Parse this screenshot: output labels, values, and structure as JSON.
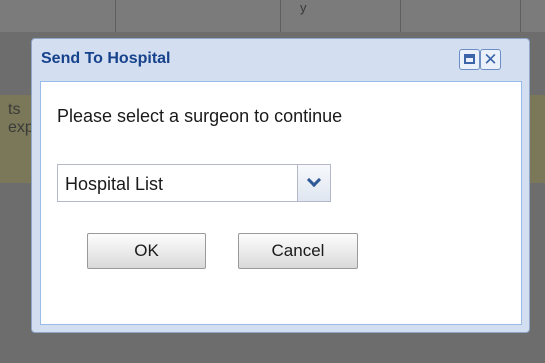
{
  "background": {
    "header_glyph": "y",
    "strip_lines": [
      "ts",
      "exp"
    ]
  },
  "dialog": {
    "title": "Send To Hospital",
    "prompt": "Please select a surgeon to continue",
    "combo": {
      "value": "Hospital List"
    },
    "buttons": {
      "ok": "OK",
      "cancel": "Cancel"
    },
    "title_icons": [
      "maximize-icon",
      "close-icon"
    ],
    "close_glyph": "✕"
  },
  "colors": {
    "title_text": "#15428b",
    "dialog_frame": "#d3dff1",
    "overlay": "#6d6d6d"
  }
}
